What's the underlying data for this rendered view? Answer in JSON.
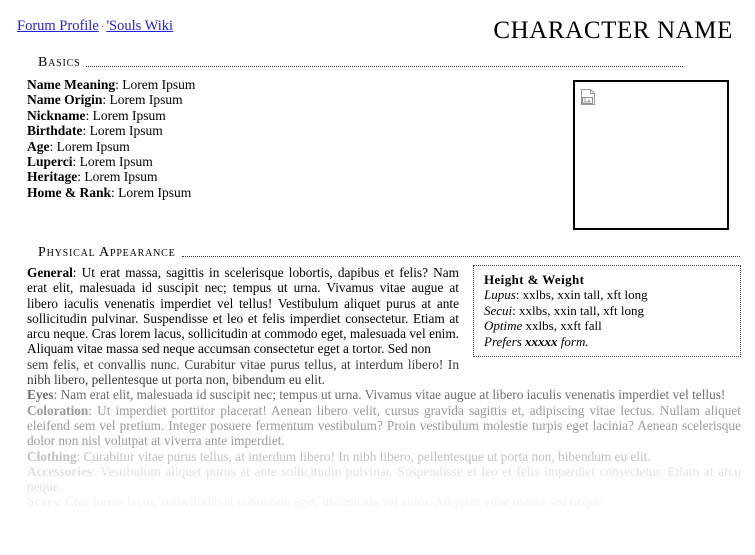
{
  "topbar": {
    "breadcrumb": {
      "forum_profile": "Forum Profile",
      "separator": "·",
      "souls_wiki": "'Souls Wiki"
    },
    "character_name": "CHARACTER NAME"
  },
  "basics": {
    "heading": "Basics",
    "rows": [
      {
        "label": "Name Meaning",
        "value": "Lorem Ipsum"
      },
      {
        "label": "Name Origin",
        "value": "Lorem Ipsum"
      },
      {
        "label": "Nickname",
        "value": "Lorem Ipsum"
      },
      {
        "label": "Birthdate",
        "value": "Lorem Ipsum"
      },
      {
        "label": "Age",
        "value": "Lorem Ipsum"
      },
      {
        "label": "Luperci",
        "value": "Lorem Ipsum"
      },
      {
        "label": "Heritage",
        "value": "Lorem Ipsum"
      },
      {
        "label": "Home & Rank",
        "value": "Lorem Ipsum"
      }
    ]
  },
  "portrait": {
    "icon": "broken-image-icon",
    "alt": ""
  },
  "physical_appearance": {
    "heading": "Physical Appearance",
    "height_weight": {
      "title": "Height & Weight",
      "lupus_label": "Lupus",
      "lupus_value": ": xxlbs, xxin tall, xft long",
      "secui_label": "Secui",
      "secui_value": ": xxlbs, xxin tall, xft long",
      "optime_label": "Optime",
      "optime_value": " xxlbs, xxft fall",
      "prefers_label": "Prefers ",
      "prefers_value": "xxxxx",
      "prefers_suffix": " form."
    },
    "general_label": "General",
    "general_text": ": Ut erat massa, sagittis in scelerisque lobortis, dapibus et felis? Nam erat elit, malesuada id suscipit nec; tempus ut urna. Vivamus vitae augue at libero iaculis venenatis imperdiet vel tellus! Vestibulum aliquet purus at ante sollicitudin pulvinar. Suspendisse et leo et felis imperdiet consectetur. Etiam at arcu neque. Cras lorem lacus, sollicitudin at commodo eget, malesuada vel enim. Aliquam vitae massa sed neque accumsan consectetur eget a tortor. Sed non",
    "general_text_cont": "sem felis, et convallis nunc. Curabitur vitae purus tellus, at interdum libero! In nibh libero, pellentesque ut porta non, bibendum eu elit.",
    "eyes_label": "Eyes",
    "eyes_text": ": Nam erat elit, malesuada id suscipit nec; tempus ut urna. Vivamus vitae augue at libero iaculis venenatis imperdiet vel tellus!",
    "coloration_label": "Coloration",
    "coloration_text": ": Ut imperdiet porttitor placerat! Aenean libero velit, cursus gravida sagittis et, adipiscing vitae lectus. Nullam aliquet eleifend sem vel pretium. Integer posuere fermentum vestibulum? Proin vestibulum molestie turpis eget lacinia? Aenean scelerisque dolor non nisl volutpat at viverra ante imperdiet.",
    "clothing_label": "Clothing",
    "clothing_text": ": Curabitur vitae purus tellus, at interdum libero! In nibh libero, pellentesque ut porta non, bibendum eu elit.",
    "accessories_label": "Accessories",
    "accessories_text": ": Vestibulum aliquet purus at ante sollicitudin pulvinar. Suspendisse et leo et felis imperdiet consectetur. Etiam at arcu neque.",
    "scars_label": "Scars",
    "scars_text": ": Cras lorem lacus, sollicitudin at commodo eget, malesuada vel enim. Aliquam vitae massa sed neque"
  },
  "colors": {
    "link": "#2222dd",
    "text": "#000000",
    "rule": "#333333",
    "box_border": "#000000"
  }
}
